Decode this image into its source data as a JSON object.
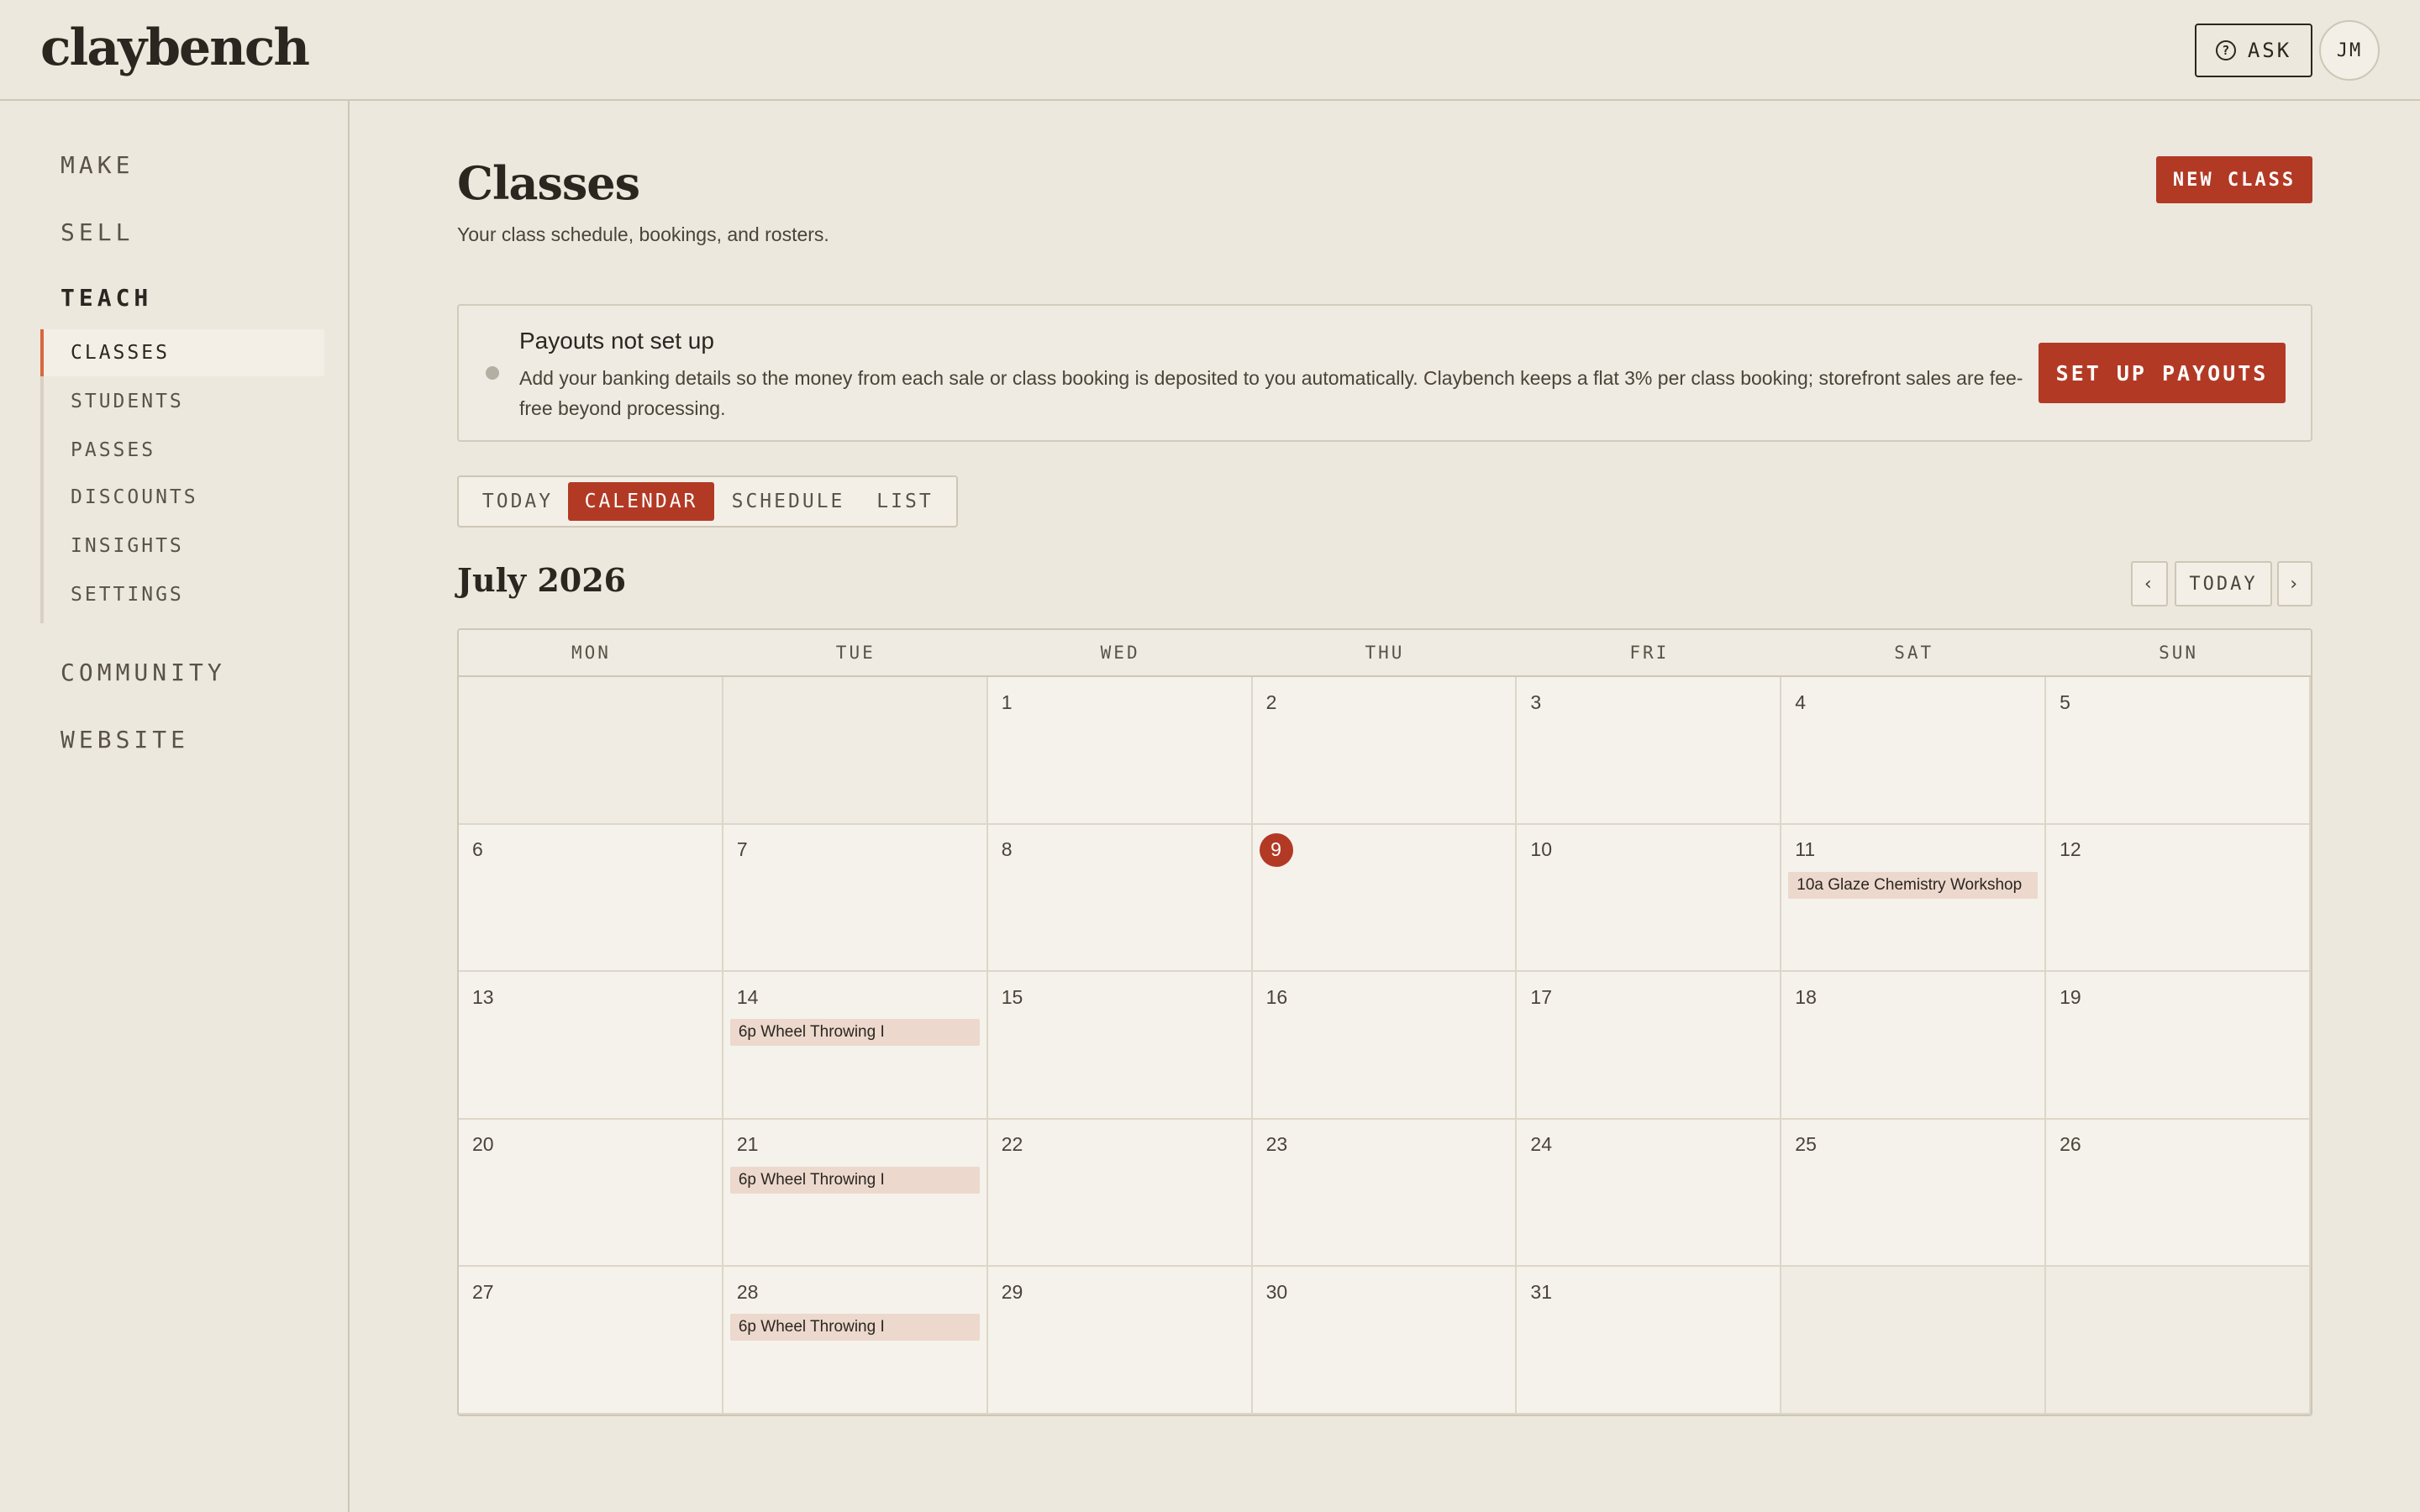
{
  "app": {
    "logo": "claybench"
  },
  "header": {
    "ask_label": "ASK",
    "avatar_initials": "JM"
  },
  "sidebar": {
    "sections": [
      "MAKE",
      "SELL",
      "TEACH",
      "COMMUNITY",
      "WEBSITE"
    ],
    "active_section": "TEACH",
    "sub_items": [
      "CLASSES",
      "STUDENTS",
      "PASSES",
      "DISCOUNTS",
      "INSIGHTS",
      "SETTINGS"
    ],
    "active_sub_item": "CLASSES"
  },
  "page": {
    "title": "Classes",
    "subtitle": "Your class schedule, bookings, and rosters.",
    "new_class_label": "NEW CLASS"
  },
  "payout_banner": {
    "title": "Payouts not set up",
    "body": "Add your banking details so the money from each sale or class booking is deposited to you automatically. Claybench keeps a flat 3% per class booking; storefront sales are fee-free beyond processing.",
    "button_label": "SET UP PAYOUTS"
  },
  "view_tabs": {
    "tabs": [
      "TODAY",
      "CALENDAR",
      "SCHEDULE",
      "LIST"
    ],
    "active": "CALENDAR"
  },
  "calendar": {
    "month_title": "July 2026",
    "prev_label": "‹",
    "today_label": "TODAY",
    "next_label": "›",
    "weekdays": [
      "MON",
      "TUE",
      "WED",
      "THU",
      "FRI",
      "SAT",
      "SUN"
    ],
    "weeks": [
      [
        null,
        null,
        1,
        2,
        3,
        4,
        5
      ],
      [
        6,
        7,
        8,
        9,
        10,
        11,
        12
      ],
      [
        13,
        14,
        15,
        16,
        17,
        18,
        19
      ],
      [
        20,
        21,
        22,
        23,
        24,
        25,
        26
      ],
      [
        27,
        28,
        29,
        30,
        31,
        null,
        null
      ]
    ],
    "today": 9,
    "events": [
      {
        "day": 11,
        "label": "10a Glaze Chemistry Workshop"
      },
      {
        "day": 14,
        "label": "6p Wheel Throwing I"
      },
      {
        "day": 21,
        "label": "6p Wheel Throwing I"
      },
      {
        "day": 28,
        "label": "6p Wheel Throwing I"
      }
    ]
  },
  "colors": {
    "accent": "#b23a25",
    "background": "#ece8dd",
    "event_bg": "#ecd8cd"
  }
}
